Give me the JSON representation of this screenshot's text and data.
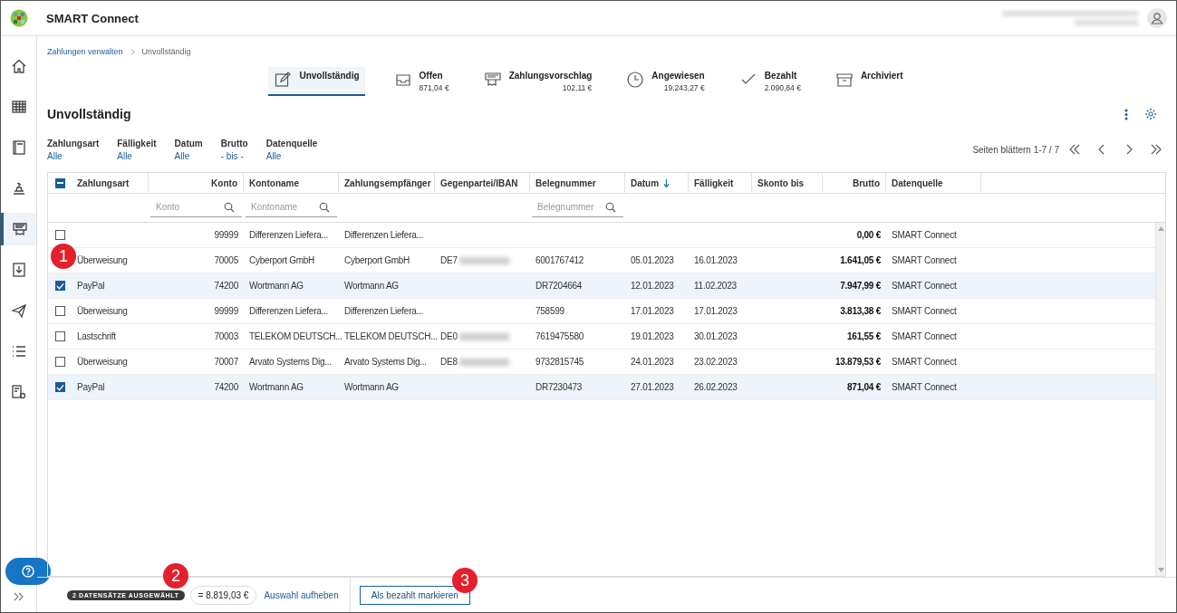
{
  "app": {
    "title": "SMART Connect"
  },
  "sidebar": {
    "items": [
      {
        "selected": false
      },
      {
        "selected": false
      },
      {
        "selected": false
      },
      {
        "selected": false
      },
      {
        "selected": true
      },
      {
        "selected": false
      },
      {
        "selected": false
      },
      {
        "selected": false
      },
      {
        "selected": false
      }
    ]
  },
  "breadcrumb": [
    "Zahlungen verwalten",
    "Unvollständig"
  ],
  "status_tabs": [
    {
      "label": "Unvollständig",
      "selected": true
    },
    {
      "label": "Offen",
      "amount": "871,04 €",
      "selected": false
    },
    {
      "label": "Zahlungsvorschlag",
      "amount": "102,11 €",
      "selected": false
    },
    {
      "label": "Angewiesen",
      "amount": "19.243,27 €",
      "selected": false
    },
    {
      "label": "Bezahlt",
      "amount": "2.090,84 €",
      "selected": false
    },
    {
      "label": "Archiviert",
      "selected": false
    }
  ],
  "page_title": "Unvollständig",
  "filters": [
    {
      "label": "Zahlungsart",
      "value": "Alle"
    },
    {
      "label": "Fälligkeit",
      "value": "Alle"
    },
    {
      "label": "Datum",
      "value": "Alle"
    },
    {
      "label": "Brutto",
      "value": "- bis -"
    },
    {
      "label": "Datenquelle",
      "value": "Alle"
    }
  ],
  "pagination": {
    "label": "Seiten blättern 1-7 / 7"
  },
  "table": {
    "select_all_partial": true,
    "columns": [
      {
        "label": "Zahlungsart",
        "sorted": false
      },
      {
        "label": "Konto",
        "filter_placeholder": "Konto",
        "sorted": false
      },
      {
        "label": "Kontoname",
        "filter_placeholder": "Kontoname",
        "sorted": false
      },
      {
        "label": "Zahlungsempfänger",
        "sorted": false
      },
      {
        "label": "Gegenpartei/IBAN",
        "sorted": false
      },
      {
        "label": "Belegnummer",
        "filter_placeholder": "Belegnummer",
        "sorted": false
      },
      {
        "label": "Datum",
        "sorted": true
      },
      {
        "label": "Fälligkeit",
        "sorted": false
      },
      {
        "label": "Skonto bis",
        "sorted": false
      },
      {
        "label": "Brutto",
        "sorted": false
      },
      {
        "label": "Datenquelle",
        "sorted": false
      }
    ],
    "rows": [
      {
        "selected": false,
        "cells": [
          null,
          "99999",
          "Differenzen Liefera...",
          "Differenzen Liefera...",
          null,
          null,
          null,
          null,
          null,
          "0,00 €",
          "SMART Connect"
        ]
      },
      {
        "cells": [
          "Überweisung",
          "70005",
          "Cyberport GmbH",
          "Cyberport GmbH",
          "DE7",
          "6001767412",
          "05.01.2023",
          "16.01.2023",
          null,
          "1.641,05 €",
          "SMART Connect"
        ]
      },
      {
        "selected": true,
        "cells": [
          "PayPal",
          "74200",
          "Wortmann AG",
          "Wortmann AG",
          null,
          "DR7204664",
          "12.01.2023",
          "11.02.2023",
          null,
          "7.947,99 €",
          "SMART Connect"
        ]
      },
      {
        "selected": false,
        "cells": [
          "Überweisung",
          "99999",
          "Differenzen Liefera...",
          "Differenzen Liefera...",
          null,
          "758599",
          "17.01.2023",
          "17.01.2023",
          null,
          "3.813,38 €",
          "SMART Connect"
        ]
      },
      {
        "selected": false,
        "cells": [
          "Lastschrift",
          "70003",
          "TELEKOM DEUTSCH...",
          "TELEKOM DEUTSCH...",
          "DE0",
          "7619475580",
          "19.01.2023",
          "30.01.2023",
          null,
          "161,55 €",
          "SMART Connect"
        ]
      },
      {
        "selected": false,
        "cells": [
          "Überweisung",
          "70007",
          "Arvato Systems Dig...",
          "Arvato Systems Dig...",
          "DE8",
          "9732815745",
          "24.01.2023",
          "23.02.2023",
          null,
          "13.879,53 €",
          "SMART Connect"
        ]
      },
      {
        "selected": true,
        "cells": [
          "PayPal",
          "74200",
          "Wortmann AG",
          "Wortmann AG",
          null,
          "DR7230473",
          "27.01.2023",
          "26.02.2023",
          null,
          "871,04 €",
          "SMART Connect"
        ]
      }
    ]
  },
  "footer": {
    "selection_badge": "2 DATENSÄTZE AUSGEWÄHLT",
    "sum": "= 8.819,03 €",
    "clear_link": "Auswahl aufheben",
    "mark_button": "Als bezahlt markieren"
  },
  "callouts": [
    {
      "label": "1"
    },
    {
      "label": "2"
    },
    {
      "label": "3"
    }
  ]
}
